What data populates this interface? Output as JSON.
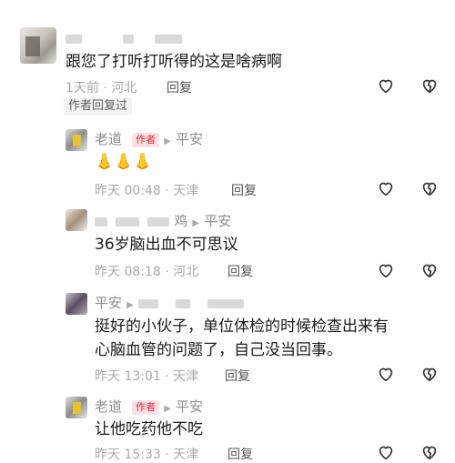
{
  "comments": [
    {
      "nickname_partial": "",
      "text": "跟您了打听打听得的这是啥病啊",
      "time_location": "1天前 · 河北",
      "reply_label": "回复",
      "author_replied_tag": "作者回复过"
    }
  ],
  "replies": [
    {
      "nickname": "老道",
      "author_tag": "作者",
      "reply_to": "平安",
      "text": "👃👃👃",
      "time_location": "昨天 00:48 · 天津",
      "reply_label": "回复"
    },
    {
      "nickname_partial": "鸡",
      "reply_to": "平安",
      "text": "36岁脑出血不可思议",
      "time_location": "昨天 08:18 · 河北",
      "reply_label": "回复"
    },
    {
      "nickname": "平安",
      "text_line1": "挺好的小伙子，单位体检的时候检查出来有",
      "text_line2": "心脑血管的问题了，自己没当回事。",
      "time_location": "昨天 13:01 · 天津",
      "reply_label": "回复"
    },
    {
      "nickname": "老道",
      "author_tag": "作者",
      "reply_to": "平安",
      "text": "让他吃药他不吃",
      "time_location": "昨天 15:33 · 天津",
      "reply_label": "回复"
    }
  ],
  "icons": {
    "like": "heart-outline-icon",
    "dislike": "broken-heart-icon"
  }
}
